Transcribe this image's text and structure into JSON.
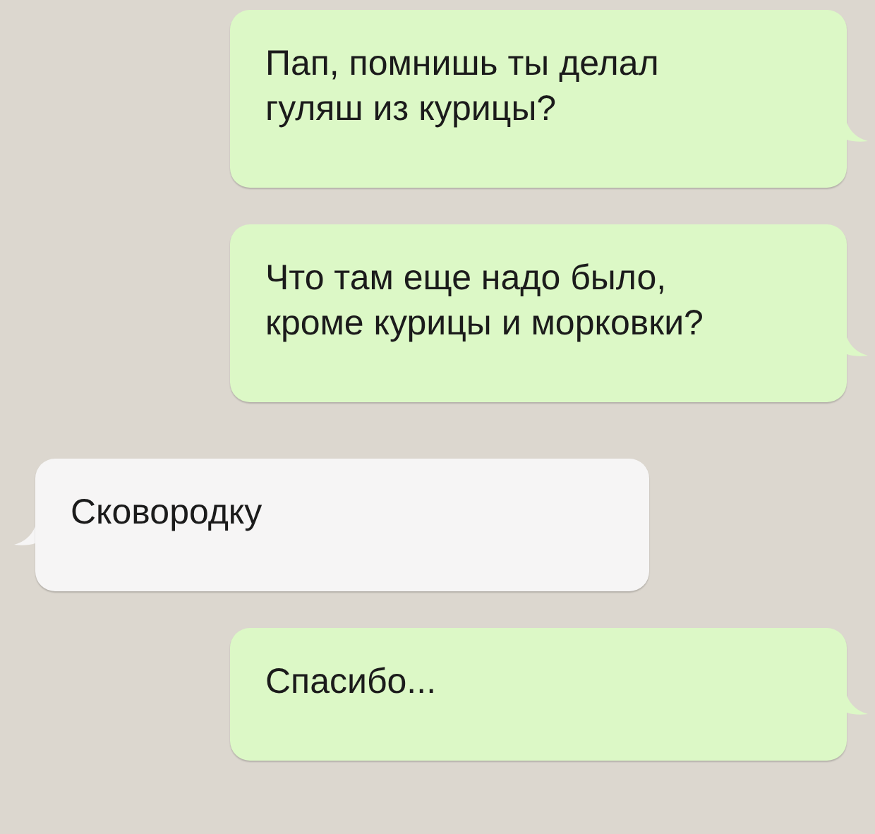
{
  "messages": [
    {
      "kind": "outgoing",
      "text": "Пап, помнишь ты делал\nгуляш из курицы?"
    },
    {
      "kind": "outgoing",
      "text": "Что там еще надо было,\nкроме курицы и морковки?"
    },
    {
      "kind": "incoming",
      "text": "Сковородку"
    },
    {
      "kind": "outgoing",
      "text": "Спасибо..."
    }
  ]
}
